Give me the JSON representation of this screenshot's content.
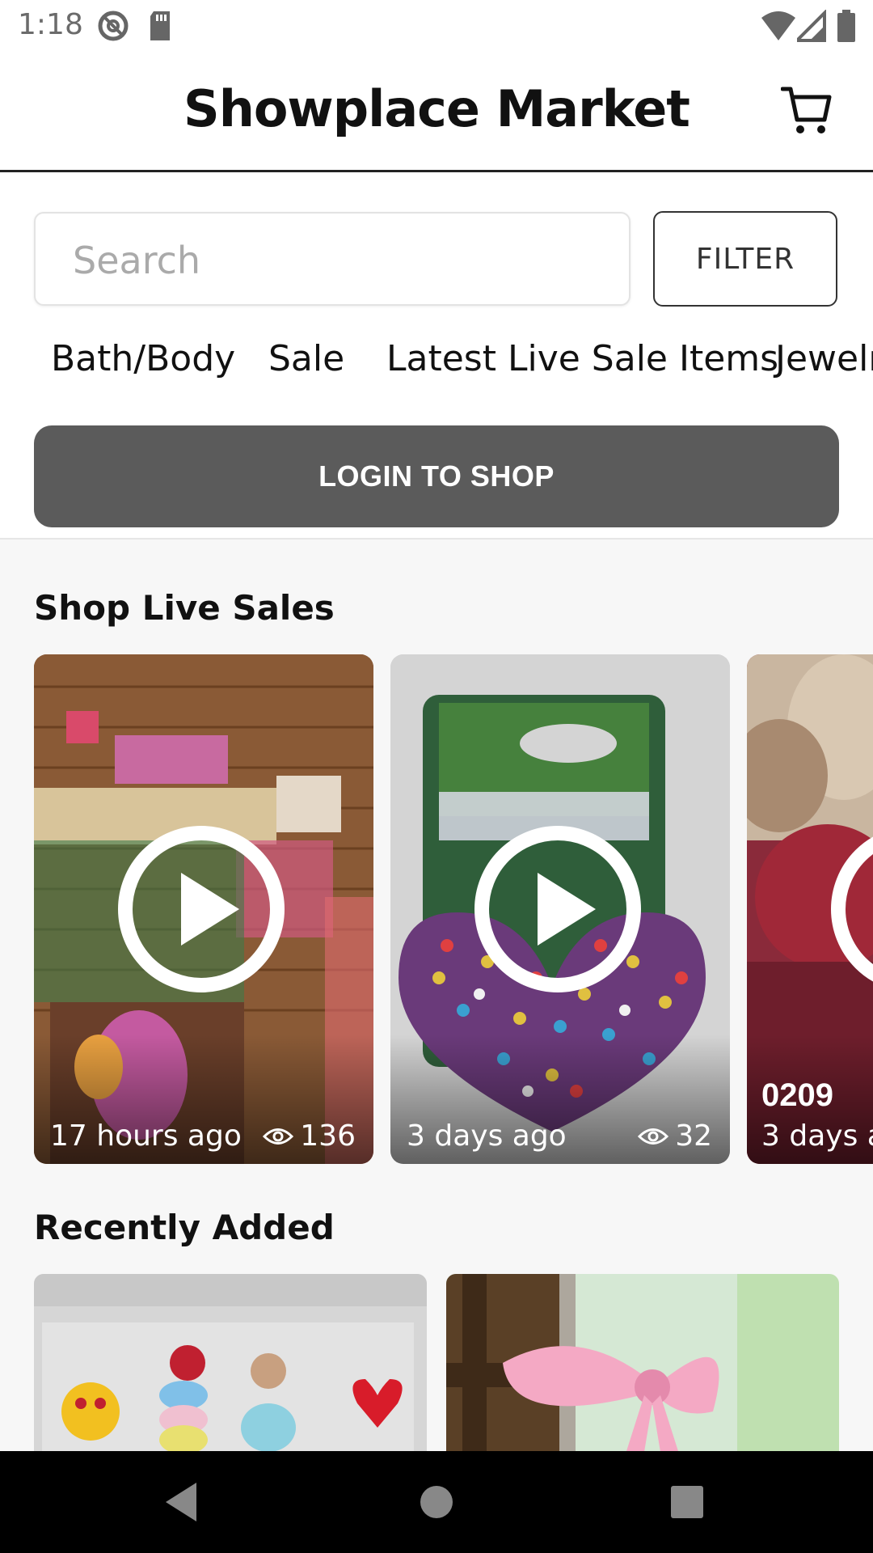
{
  "status": {
    "time": "1:18"
  },
  "header": {
    "title": "Showplace Market"
  },
  "search": {
    "placeholder": "Search",
    "value": ""
  },
  "filter": {
    "label": "FILTER"
  },
  "categories": [
    {
      "label": "Bath/Body"
    },
    {
      "label": "Sale"
    },
    {
      "label": "Latest Live Sale Items"
    },
    {
      "label": "Jewelr"
    }
  ],
  "login": {
    "label": "LOGIN TO SHOP"
  },
  "live_sales": {
    "title": "Shop Live Sales",
    "cards": [
      {
        "time": "17 hours ago",
        "views": "136"
      },
      {
        "time": "3 days ago",
        "views": "32"
      },
      {
        "code": "0209",
        "time": "3 days a"
      }
    ]
  },
  "recently_added": {
    "title": "Recently Added"
  },
  "colors": {
    "login_bg": "#5b5b5b",
    "nav_bg": "#000000",
    "page_bg": "#f7f7f7"
  }
}
